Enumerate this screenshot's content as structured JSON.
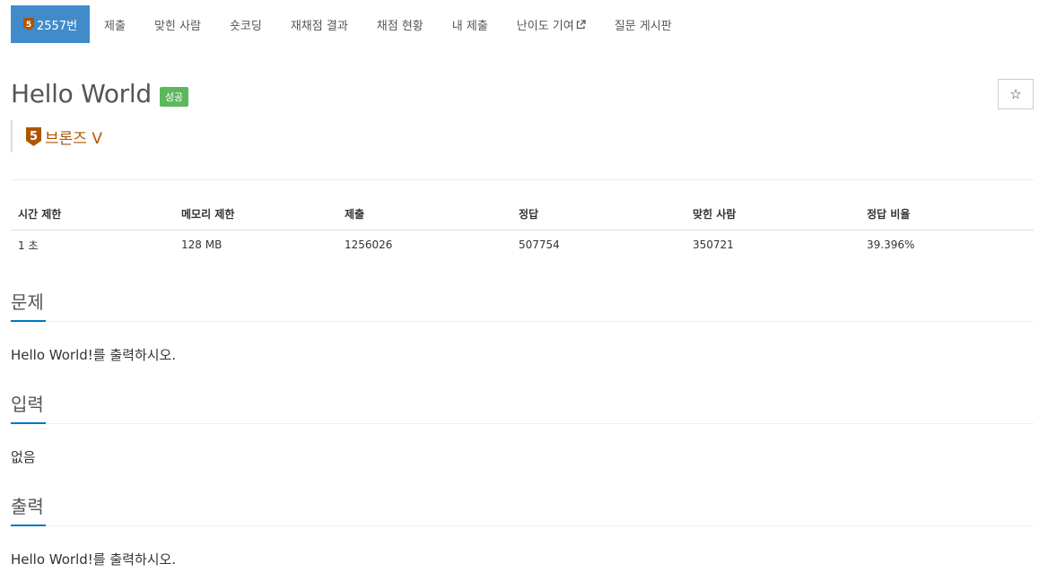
{
  "nav": {
    "items": [
      {
        "label": "2557번"
      },
      {
        "label": "제출"
      },
      {
        "label": "맞힌 사람"
      },
      {
        "label": "숏코딩"
      },
      {
        "label": "재채점 결과"
      },
      {
        "label": "채점 현황"
      },
      {
        "label": "내 제출"
      },
      {
        "label": "난이도 기여"
      },
      {
        "label": "질문 게시판"
      }
    ],
    "active_color": "#428bca",
    "tier_number": "5",
    "external_link_icon": "external-link-icon"
  },
  "problem": {
    "title": "Hello World",
    "status_badge": "성공",
    "status_color": "#5cb85c",
    "star_icon": "☆",
    "tier_label": "브론즈 V",
    "tier_number": "5",
    "tier_color": "#ad5600"
  },
  "stats": {
    "headers": [
      "시간 제한",
      "메모리 제한",
      "제출",
      "정답",
      "맞힌 사람",
      "정답 비율"
    ],
    "values": [
      "1 초",
      "128 MB",
      "1256026",
      "507754",
      "350721",
      "39.396%"
    ]
  },
  "sections": [
    {
      "title": "문제",
      "body": "Hello World!를 출력하시오."
    },
    {
      "title": "입력",
      "body": "없음"
    },
    {
      "title": "출력",
      "body": "Hello World!를 출력하시오."
    }
  ]
}
